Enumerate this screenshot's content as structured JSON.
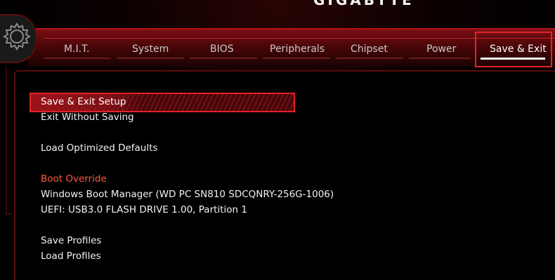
{
  "brand": {
    "logo_text": "GIGABYTE"
  },
  "tabs": [
    {
      "label": "M.I.T."
    },
    {
      "label": "System"
    },
    {
      "label": "BIOS"
    },
    {
      "label": "Peripherals"
    },
    {
      "label": "Chipset"
    },
    {
      "label": "Power"
    },
    {
      "label": "Save & Exit",
      "active": true
    }
  ],
  "menu": {
    "save_exit_setup": "Save & Exit Setup",
    "exit_without_saving": "Exit Without Saving",
    "load_optimized_defaults": "Load Optimized Defaults",
    "boot_override_header": "Boot Override",
    "boot_windows": "Windows Boot Manager (WD PC SN810 SDCQNRY-256G-1006)",
    "boot_uefi_usb": "UEFI: USB3.0 FLASH DRIVE 1.00, Partition 1",
    "save_profiles": "Save Profiles",
    "load_profiles": "Load Profiles"
  },
  "colors": {
    "accent_red": "#e3222a",
    "header_orange": "#ff5a3a",
    "text": "#f2f2f2"
  }
}
